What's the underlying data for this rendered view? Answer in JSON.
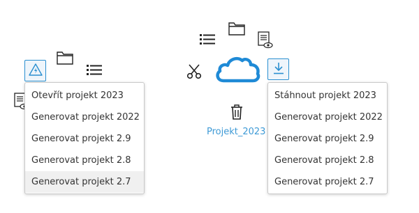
{
  "left_cluster": {
    "menu_items": [
      "Otevřít projekt 2023",
      "Generovat projekt 2022",
      "Generovat projekt 2.9",
      "Generovat projekt 2.8",
      "Generovat projekt 2.7"
    ],
    "highlighted_index": 4,
    "icons": [
      "warning-triangle-icon",
      "folder-icon",
      "list-icon",
      "document-preview-icon"
    ]
  },
  "right_cluster": {
    "project_name": "Projekt_2023",
    "menu_items": [
      "Stáhnout projekt 2023",
      "Generovat projekt 2022",
      "Generovat projekt 2.9",
      "Generovat projekt 2.8",
      "Generovat projekt 2.7"
    ],
    "icons": [
      "cloud-icon",
      "list-icon",
      "folder-icon",
      "document-preview-icon",
      "scissors-icon",
      "download-icon",
      "trash-icon"
    ]
  },
  "colors": {
    "accent": "#2a8fd0",
    "cloud": "#1f8ad6",
    "label": "#3e9ad6",
    "icon": "#222222"
  }
}
